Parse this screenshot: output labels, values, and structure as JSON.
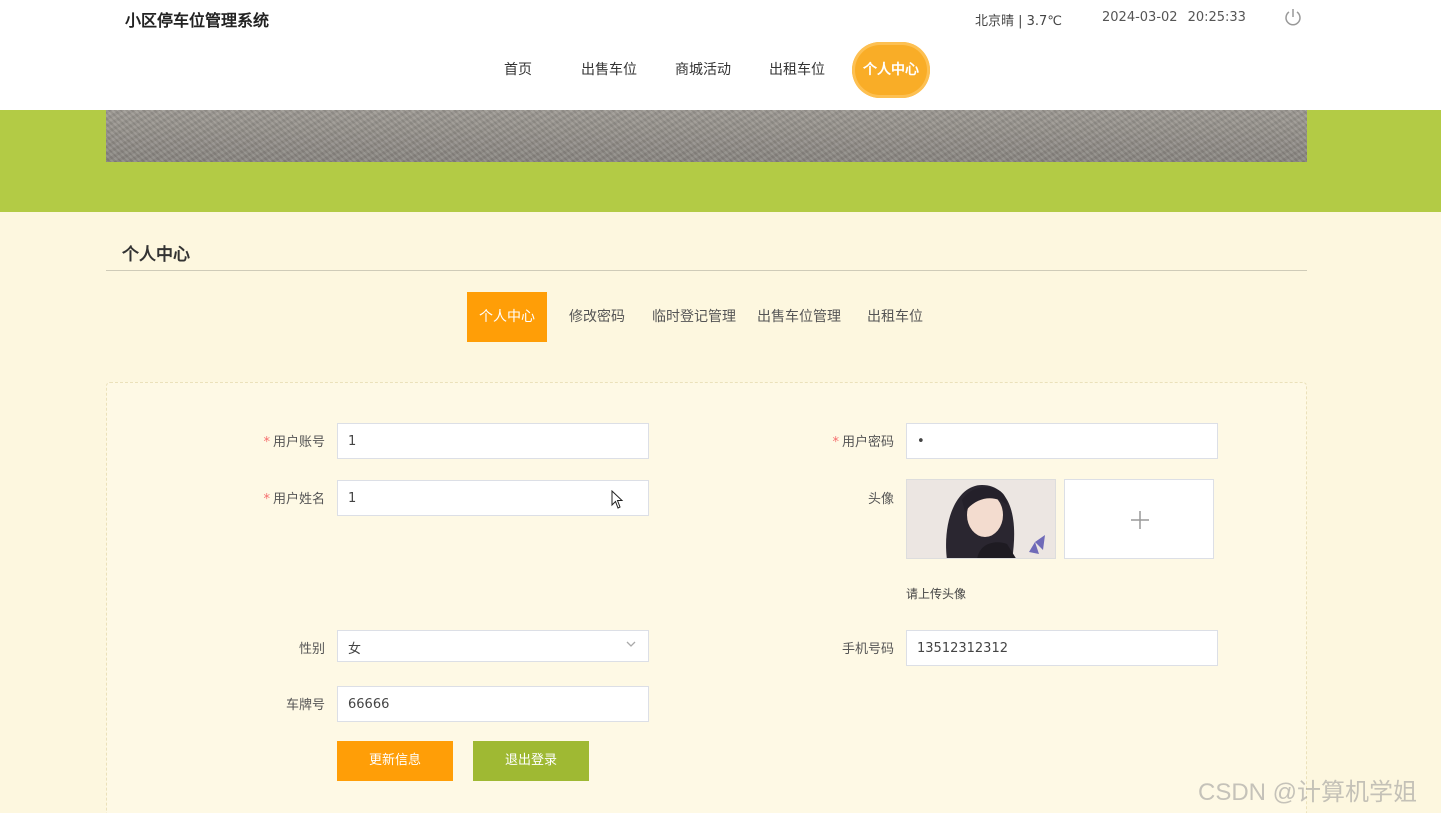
{
  "header": {
    "site_title": "小区停车位管理系统",
    "weather": "北京晴 | 3.7℃",
    "date": "2024-03-02",
    "time": "20:25:33",
    "power_icon": "power-icon"
  },
  "nav": {
    "items": [
      {
        "label": "首页"
      },
      {
        "label": "出售车位"
      },
      {
        "label": "商城活动"
      },
      {
        "label": "出租车位"
      },
      {
        "label": "个人中心"
      }
    ],
    "active": "个人中心"
  },
  "section": {
    "title": "个人中心"
  },
  "tabs": {
    "items": [
      {
        "label": "个人中心"
      },
      {
        "label": "修改密码"
      },
      {
        "label": "临时登记管理"
      },
      {
        "label": "出售车位管理"
      },
      {
        "label": "出租车位"
      }
    ],
    "active": "个人中心"
  },
  "form": {
    "required_mark": "*",
    "username_label": "用户账号",
    "username_value": "1",
    "password_label": "用户密码",
    "password_value": "•",
    "name_label": "用户姓名",
    "name_value": "1",
    "avatar_label": "头像",
    "avatar_hint": "请上传头像",
    "gender_label": "性别",
    "gender_value": "女",
    "phone_label": "手机号码",
    "phone_value": "13512312312",
    "plate_label": "车牌号",
    "plate_value": "66666",
    "update_button": "更新信息",
    "logout_button": "退出登录"
  },
  "colors": {
    "accent_orange": "#ff9e07",
    "accent_green": "#b3cb45",
    "logout_green": "#9fb933",
    "page_bg": "#fdf7df"
  },
  "watermark": "CSDN @计算机学姐"
}
